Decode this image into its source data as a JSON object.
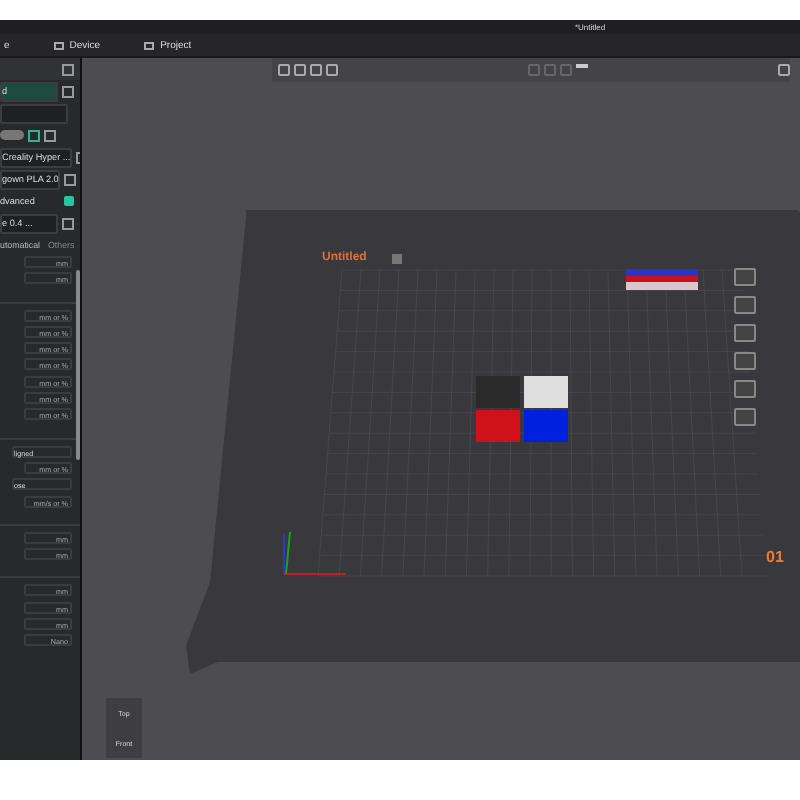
{
  "window": {
    "title": "*Untitled"
  },
  "menu": [
    {
      "label": "e",
      "icon": false
    },
    {
      "label": "Device",
      "icon": true
    },
    {
      "label": "Project",
      "icon": true
    }
  ],
  "sidebar": {
    "printer": "d",
    "printer_preset": "Creality Hyper ...",
    "filament": "gown PLA 2.0",
    "mode": "dvanced",
    "advanced_on": true,
    "nozzle": "e 0.4 ...",
    "tabs": [
      {
        "label": "utomatical",
        "selected": true
      },
      {
        "label": "Others",
        "selected": false
      }
    ],
    "params": [
      {
        "kind": "unit",
        "unit": "mm"
      },
      {
        "kind": "unit",
        "unit": "mm"
      },
      {
        "kind": "gap"
      },
      {
        "kind": "unit",
        "unit": "mm or %"
      },
      {
        "kind": "unit",
        "unit": "mm or %"
      },
      {
        "kind": "unit",
        "unit": "mm or %"
      },
      {
        "kind": "unit",
        "unit": "mm or %"
      },
      {
        "kind": "unit",
        "unit": "mm or %"
      },
      {
        "kind": "unit",
        "unit": "mm or %"
      },
      {
        "kind": "unit",
        "unit": "mm or %"
      },
      {
        "kind": "gap"
      },
      {
        "kind": "select",
        "value": "ligned"
      },
      {
        "kind": "unit",
        "unit": "mm or %"
      },
      {
        "kind": "select",
        "value": "ose"
      },
      {
        "kind": "unit",
        "unit": "mm/s or %"
      },
      {
        "kind": "gap"
      },
      {
        "kind": "unit",
        "unit": "mm"
      },
      {
        "kind": "unit",
        "unit": "mm"
      },
      {
        "kind": "gap"
      },
      {
        "kind": "unit",
        "unit": "mm"
      },
      {
        "kind": "unit",
        "unit": "mm"
      },
      {
        "kind": "unit",
        "unit": "mm"
      },
      {
        "kind": "unit",
        "unit": "Nano"
      }
    ]
  },
  "plate": {
    "name": "Untitled",
    "number": "01"
  },
  "view_cube": {
    "top": "Top",
    "front": "Front"
  }
}
